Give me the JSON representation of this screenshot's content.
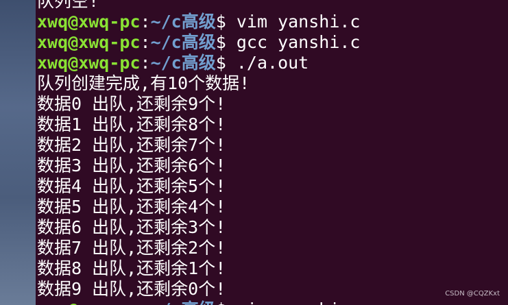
{
  "colors": {
    "terminal_bg": "#300a24",
    "prompt_user": "#8ae234",
    "prompt_path": "#729fcf",
    "text": "#ffffff"
  },
  "terminal": {
    "top_partial_line": "队列空!",
    "prompt": {
      "user_host": "xwq@xwq-pc",
      "separator": ":",
      "path": "~/c高级",
      "symbol": "$"
    },
    "commands": [
      "vim yanshi.c",
      "gcc yanshi.c",
      "./a.out"
    ],
    "output": [
      "队列创建完成,有10个数据!",
      "数据0 出队,还剩余9个!",
      "数据1 出队,还剩余8个!",
      "数据2 出队,还剩余7个!",
      "数据3 出队,还剩余6个!",
      "数据4 出队,还剩余5个!",
      "数据5 出队,还剩余4个!",
      "数据6 出队,还剩余3个!",
      "数据7 出队,还剩余2个!",
      "数据8 出队,还剩余1个!",
      "数据9 出队,还剩余0个!"
    ],
    "bottom_partial_command": "vim yanshi.c"
  },
  "watermark": "CSDN @CQZKxt"
}
